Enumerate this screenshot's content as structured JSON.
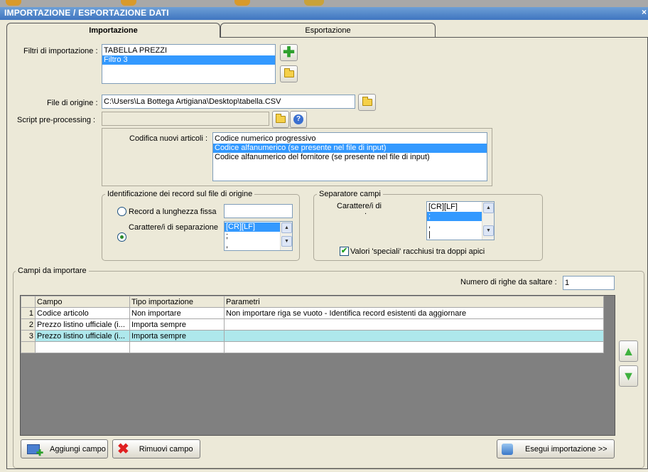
{
  "window": {
    "title": "IMPORTAZIONE / ESPORTAZIONE DATI",
    "close_label": "×"
  },
  "tabs": [
    {
      "label": "Importazione",
      "active": true
    },
    {
      "label": "Esportazione",
      "active": false
    }
  ],
  "filters": {
    "label": "Filtri di importazione :",
    "items": [
      {
        "label": "TABELLA PREZZI"
      },
      {
        "label": "Filtro 3",
        "selected": true
      }
    ]
  },
  "source_file": {
    "label": "File di origine :",
    "value": "C:\\Users\\La Bottega Artigiana\\Desktop\\tabella.CSV"
  },
  "script": {
    "label": "Script pre-processing :",
    "value": ""
  },
  "coding": {
    "label": "Codifica nuovi articoli :",
    "options": [
      {
        "label": "Codice numerico progressivo"
      },
      {
        "label": "Codice alfanumerico (se presente nel file di input)",
        "selected": true
      },
      {
        "label": "Codice alfanumerico del fornitore (se presente nel file di input)"
      }
    ]
  },
  "record_id": {
    "legend": "Identificazione dei record sul file di origine",
    "fixed_label": "Record a lunghezza fissa",
    "fixed_value": "",
    "sep_label": "Carattere/i di separazione",
    "selected": "sep",
    "sep_options": [
      "[CR][LF]",
      ";",
      ","
    ]
  },
  "field_sep": {
    "legend": "Separatore campi",
    "label": "Carattere/i di",
    "label2": ".",
    "options": [
      "[CR][LF]",
      ";",
      ",",
      "|"
    ],
    "quotes_label": "Valori 'speciali' racchiusi tra doppi apici",
    "quotes_checked": true,
    "check_glyph": "✔"
  },
  "fields": {
    "legend": "Campi da importare",
    "skip_label": "Numero di righe da saltare :",
    "skip_value": "1",
    "columns": [
      "Campo",
      "Tipo importazione",
      "Parametri"
    ],
    "rows": [
      {
        "n": "1",
        "campo": "Codice articolo",
        "tipo": "Non importare",
        "param": "Non importare riga se vuoto - Identifica record esistenti da aggiornare"
      },
      {
        "n": "2",
        "campo": "Prezzo listino ufficiale (i...",
        "tipo": "Importa sempre",
        "param": ""
      },
      {
        "n": "3",
        "campo": "Prezzo listino ufficiale (i...",
        "tipo": "Importa sempre",
        "param": ""
      }
    ]
  },
  "buttons": {
    "add": "Aggiungi campo",
    "remove": "Rimuovi campo",
    "run": "Esegui importazione >>"
  },
  "glyphs": {
    "plus": "✚",
    "help": "?",
    "remove": "✖",
    "up": "▲",
    "down": "▼"
  },
  "colors": {
    "title_bar": "#3f75c0",
    "selection": "#3399ff",
    "highlight_row": "#aee8ec",
    "grid_bg": "#808080"
  }
}
